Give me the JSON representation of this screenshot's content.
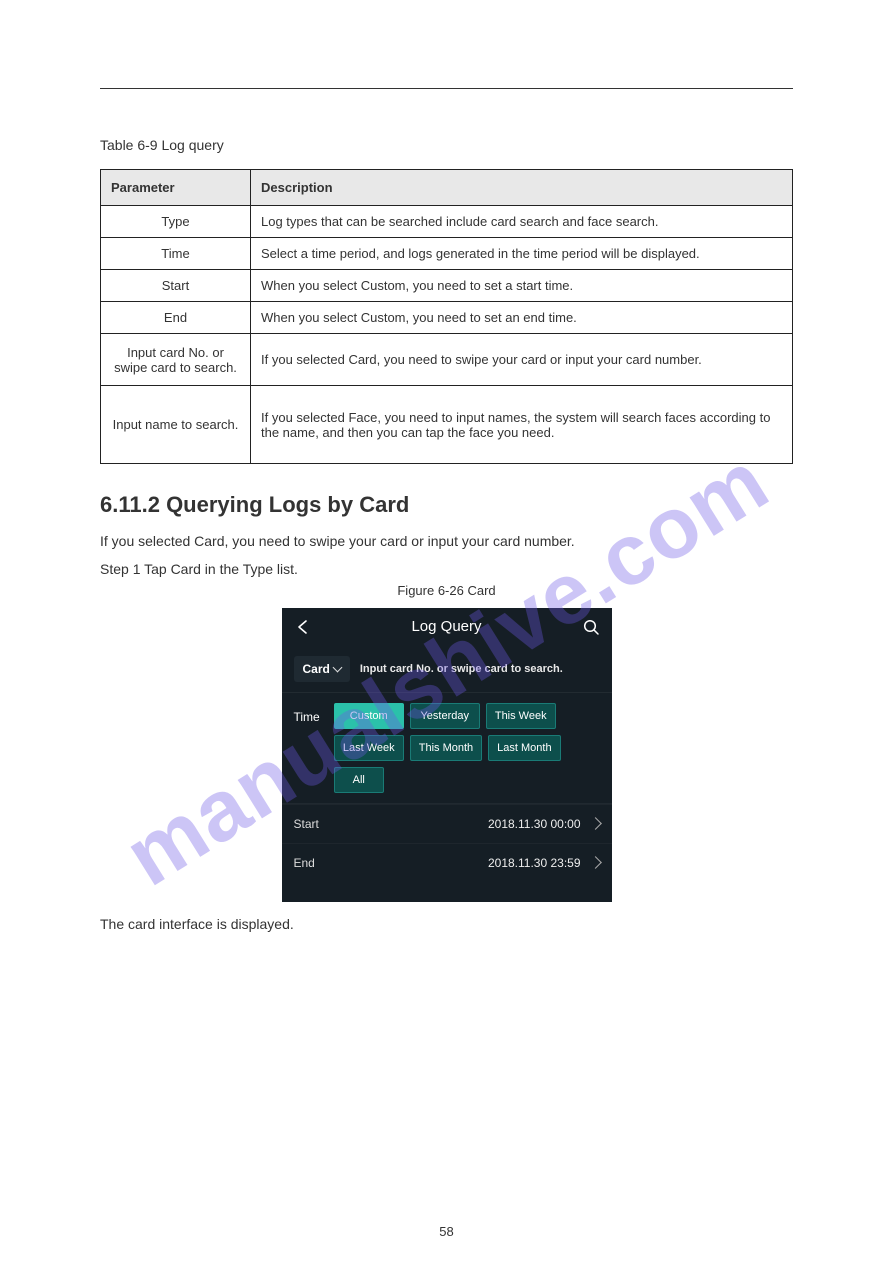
{
  "watermark_text": "manualshive.com",
  "intro_text": "Table 6-9 Log query",
  "table": {
    "headers": [
      "Parameter",
      "Description"
    ],
    "rows": [
      {
        "p": "Type",
        "d": "Log types that can be searched include card search and face search."
      },
      {
        "p": "Time",
        "d": "Select a time period, and logs generated in the time period will be displayed."
      },
      {
        "p": "Start",
        "d": "When you select Custom, you need to set a start time."
      },
      {
        "p": "End",
        "d": "When you select Custom, you need to set an end time."
      },
      {
        "p": "Input card No. or swipe card to search.",
        "d": "If you selected Card, you need to swipe your card or input your card number."
      },
      {
        "p": "Input name to search.",
        "d": "If you selected Face, you need to input names, the system will search faces according to the name, and then you can tap the face you need."
      }
    ]
  },
  "section_title": "6.11.2 Querying Logs by Card",
  "body_line": "If you selected Card, you need to swipe your card or input your card number.",
  "step_text": "Step 1   Tap Card in the Type list.",
  "figure_caption": "Figure 6-26 Card",
  "after_caption_text": "The card interface is displayed.",
  "log_query": {
    "title": "Log Query",
    "card_label": "Card",
    "search_hint": "Input card No. or swipe card to search.",
    "time_label": "Time",
    "chips": [
      "Custom",
      "Yesterday",
      "This Week",
      "Last Week",
      "This Month",
      "Last Month",
      "All"
    ],
    "active_chip_index": 0,
    "start_label": "Start",
    "start_value": "2018.11.30  00:00",
    "end_label": "End",
    "end_value": "2018.11.30  23:59"
  },
  "page_number": "58"
}
